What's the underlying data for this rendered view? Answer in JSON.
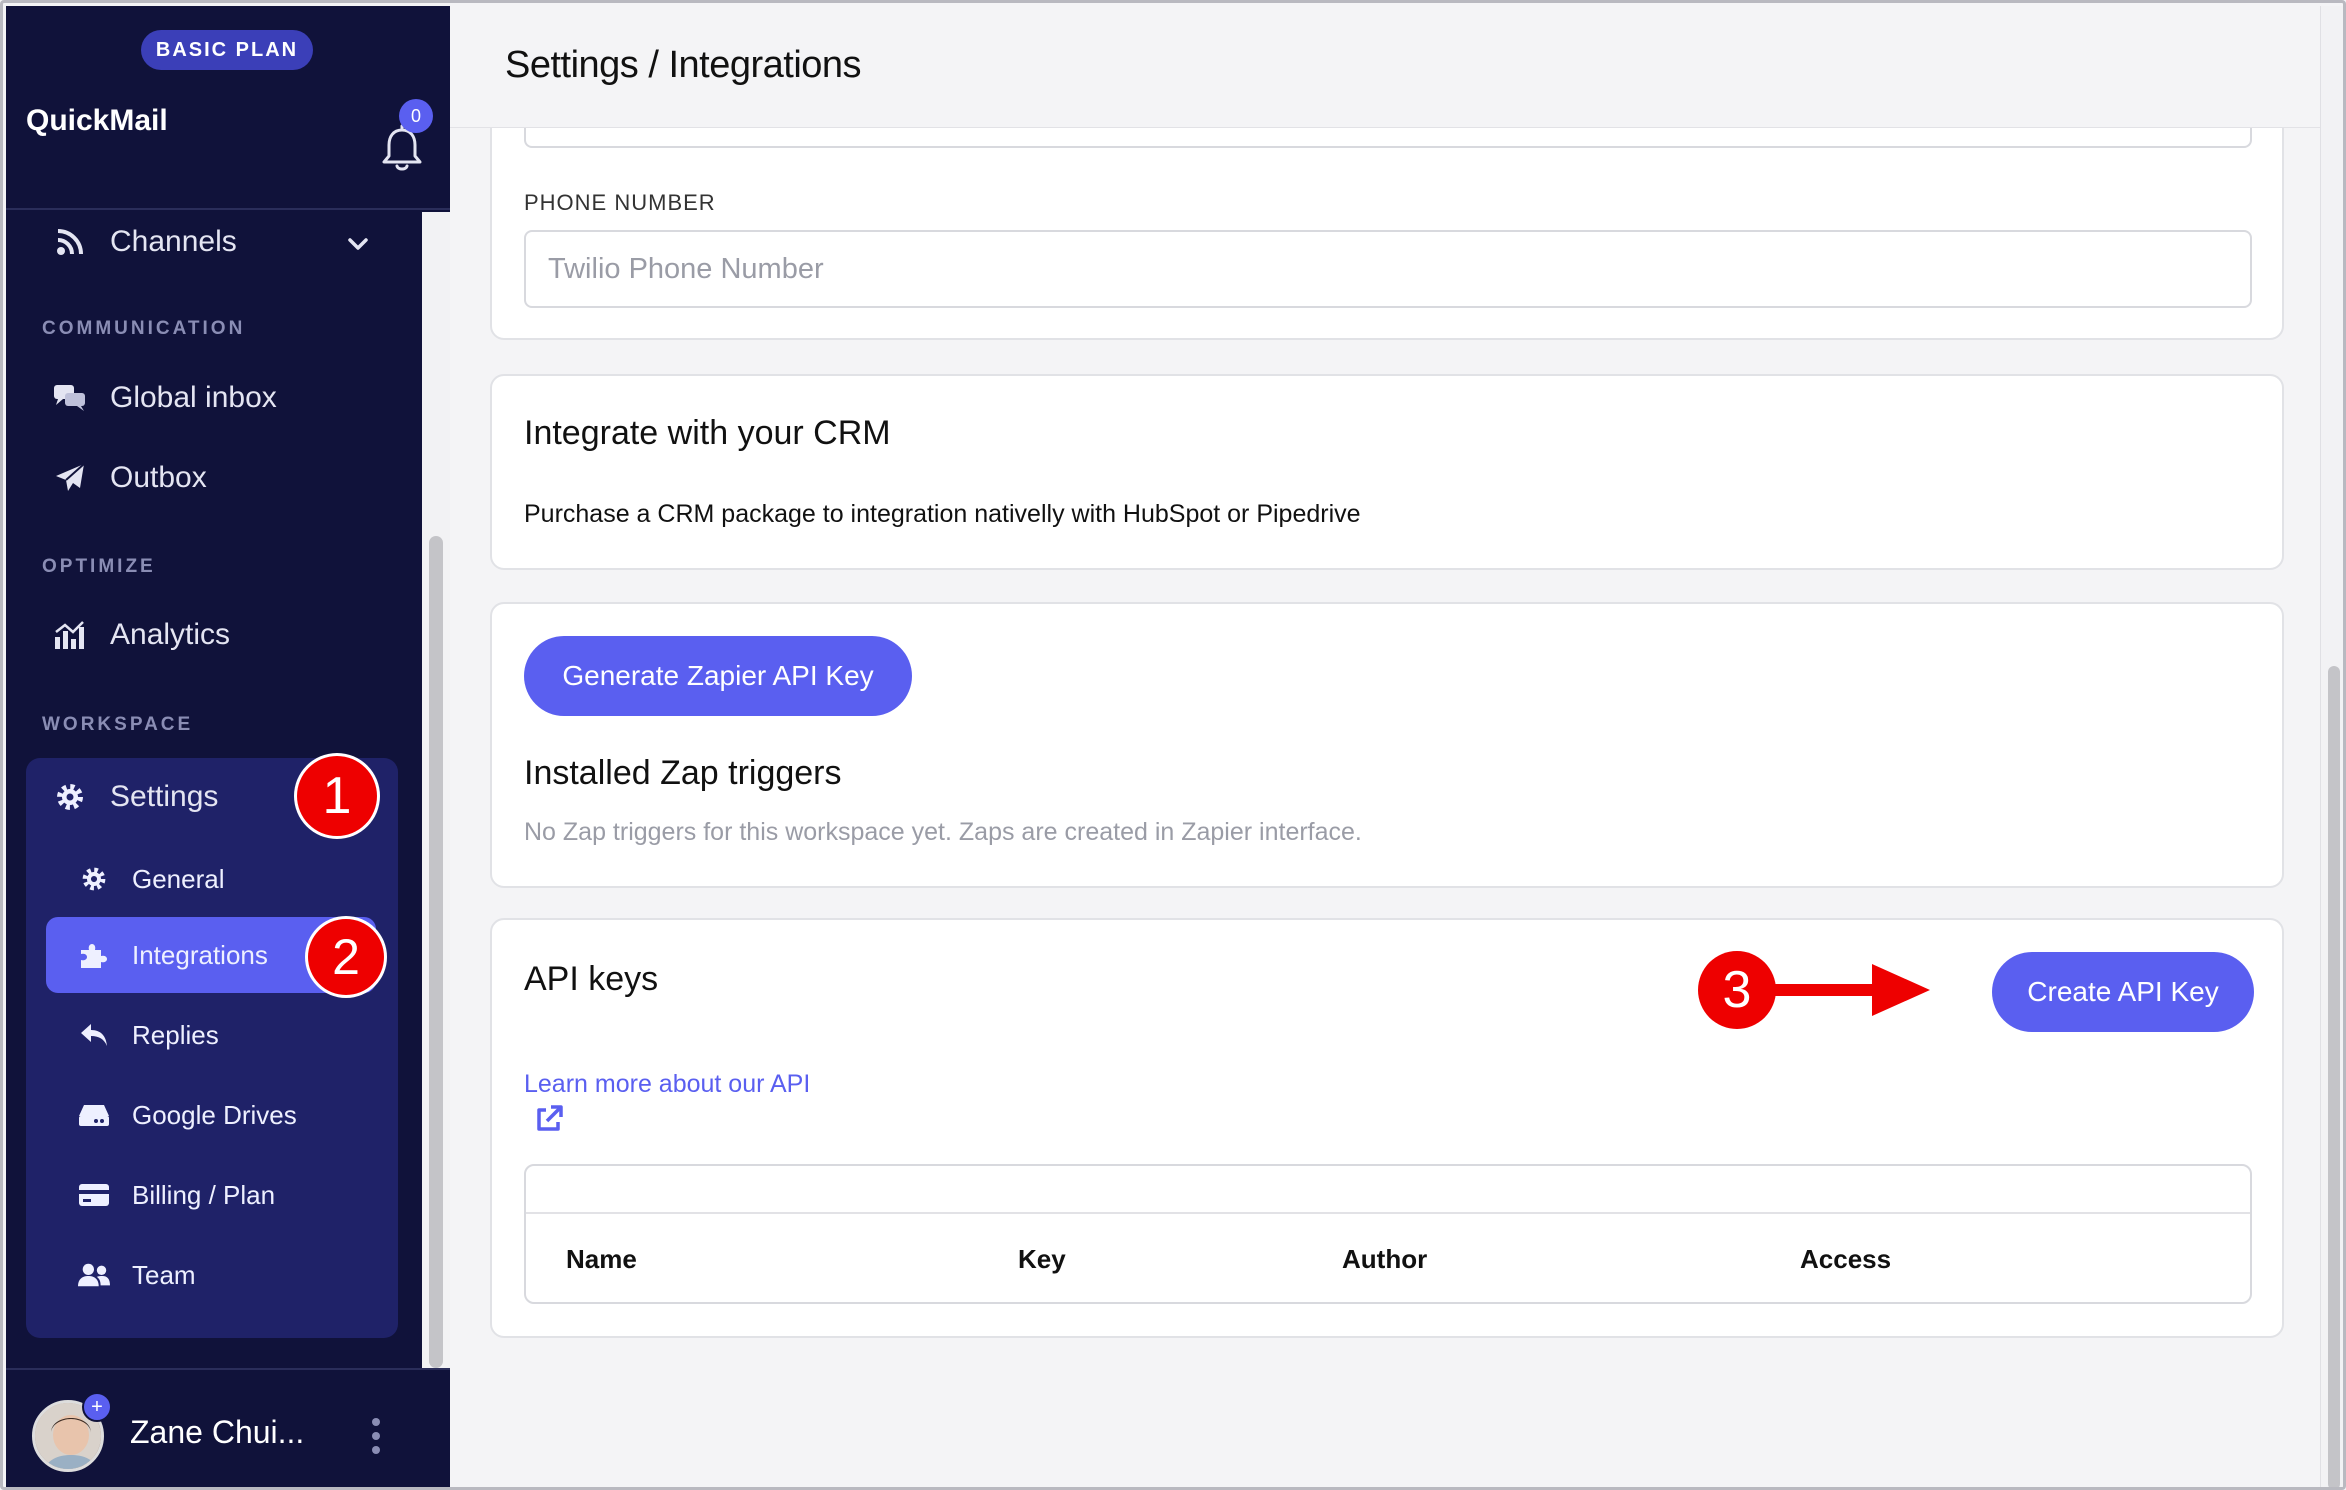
{
  "sidebar": {
    "plan_badge": "BASIC PLAN",
    "app_name": "QuickMail",
    "notification_count": "0",
    "channels_label": "Channels",
    "sections": {
      "communication": "COMMUNICATION",
      "optimize": "OPTIMIZE",
      "workspace": "WORKSPACE"
    },
    "items": {
      "global_inbox": "Global inbox",
      "outbox": "Outbox",
      "analytics": "Analytics",
      "settings": "Settings"
    },
    "settings_sub": [
      {
        "label": "General",
        "icon": "gear-icon"
      },
      {
        "label": "Integrations",
        "icon": "puzzle-icon"
      },
      {
        "label": "Replies",
        "icon": "reply-icon"
      },
      {
        "label": "Google Drives",
        "icon": "drive-icon"
      },
      {
        "label": "Billing / Plan",
        "icon": "credit-card-icon"
      },
      {
        "label": "Team",
        "icon": "users-icon"
      }
    ],
    "user_name": "Zane Chui...",
    "avatar_plus": "+"
  },
  "main": {
    "title": "Settings / Integrations",
    "twilio": {
      "phone_label": "PHONE NUMBER",
      "phone_placeholder": "Twilio Phone Number"
    },
    "crm": {
      "title": "Integrate with your CRM",
      "text": "Purchase a CRM package to integration nativelly with HubSpot or Pipedrive"
    },
    "zapier": {
      "button": "Generate Zapier API Key",
      "triggers_title": "Installed Zap triggers",
      "triggers_empty": "No Zap triggers for this workspace yet. Zaps are created in Zapier interface."
    },
    "api_keys": {
      "title": "API keys",
      "create_button": "Create API Key",
      "learn_more": "Learn more about our API",
      "columns": [
        "Name",
        "Key",
        "Author",
        "Access"
      ]
    }
  },
  "annotations": {
    "marker_1": "1",
    "marker_2": "2",
    "marker_3": "3",
    "marker_color": "#ee0000"
  },
  "colors": {
    "sidebar_bg": "#10123a",
    "settings_group_bg": "#1f2268",
    "accent": "#5a5ff0"
  }
}
